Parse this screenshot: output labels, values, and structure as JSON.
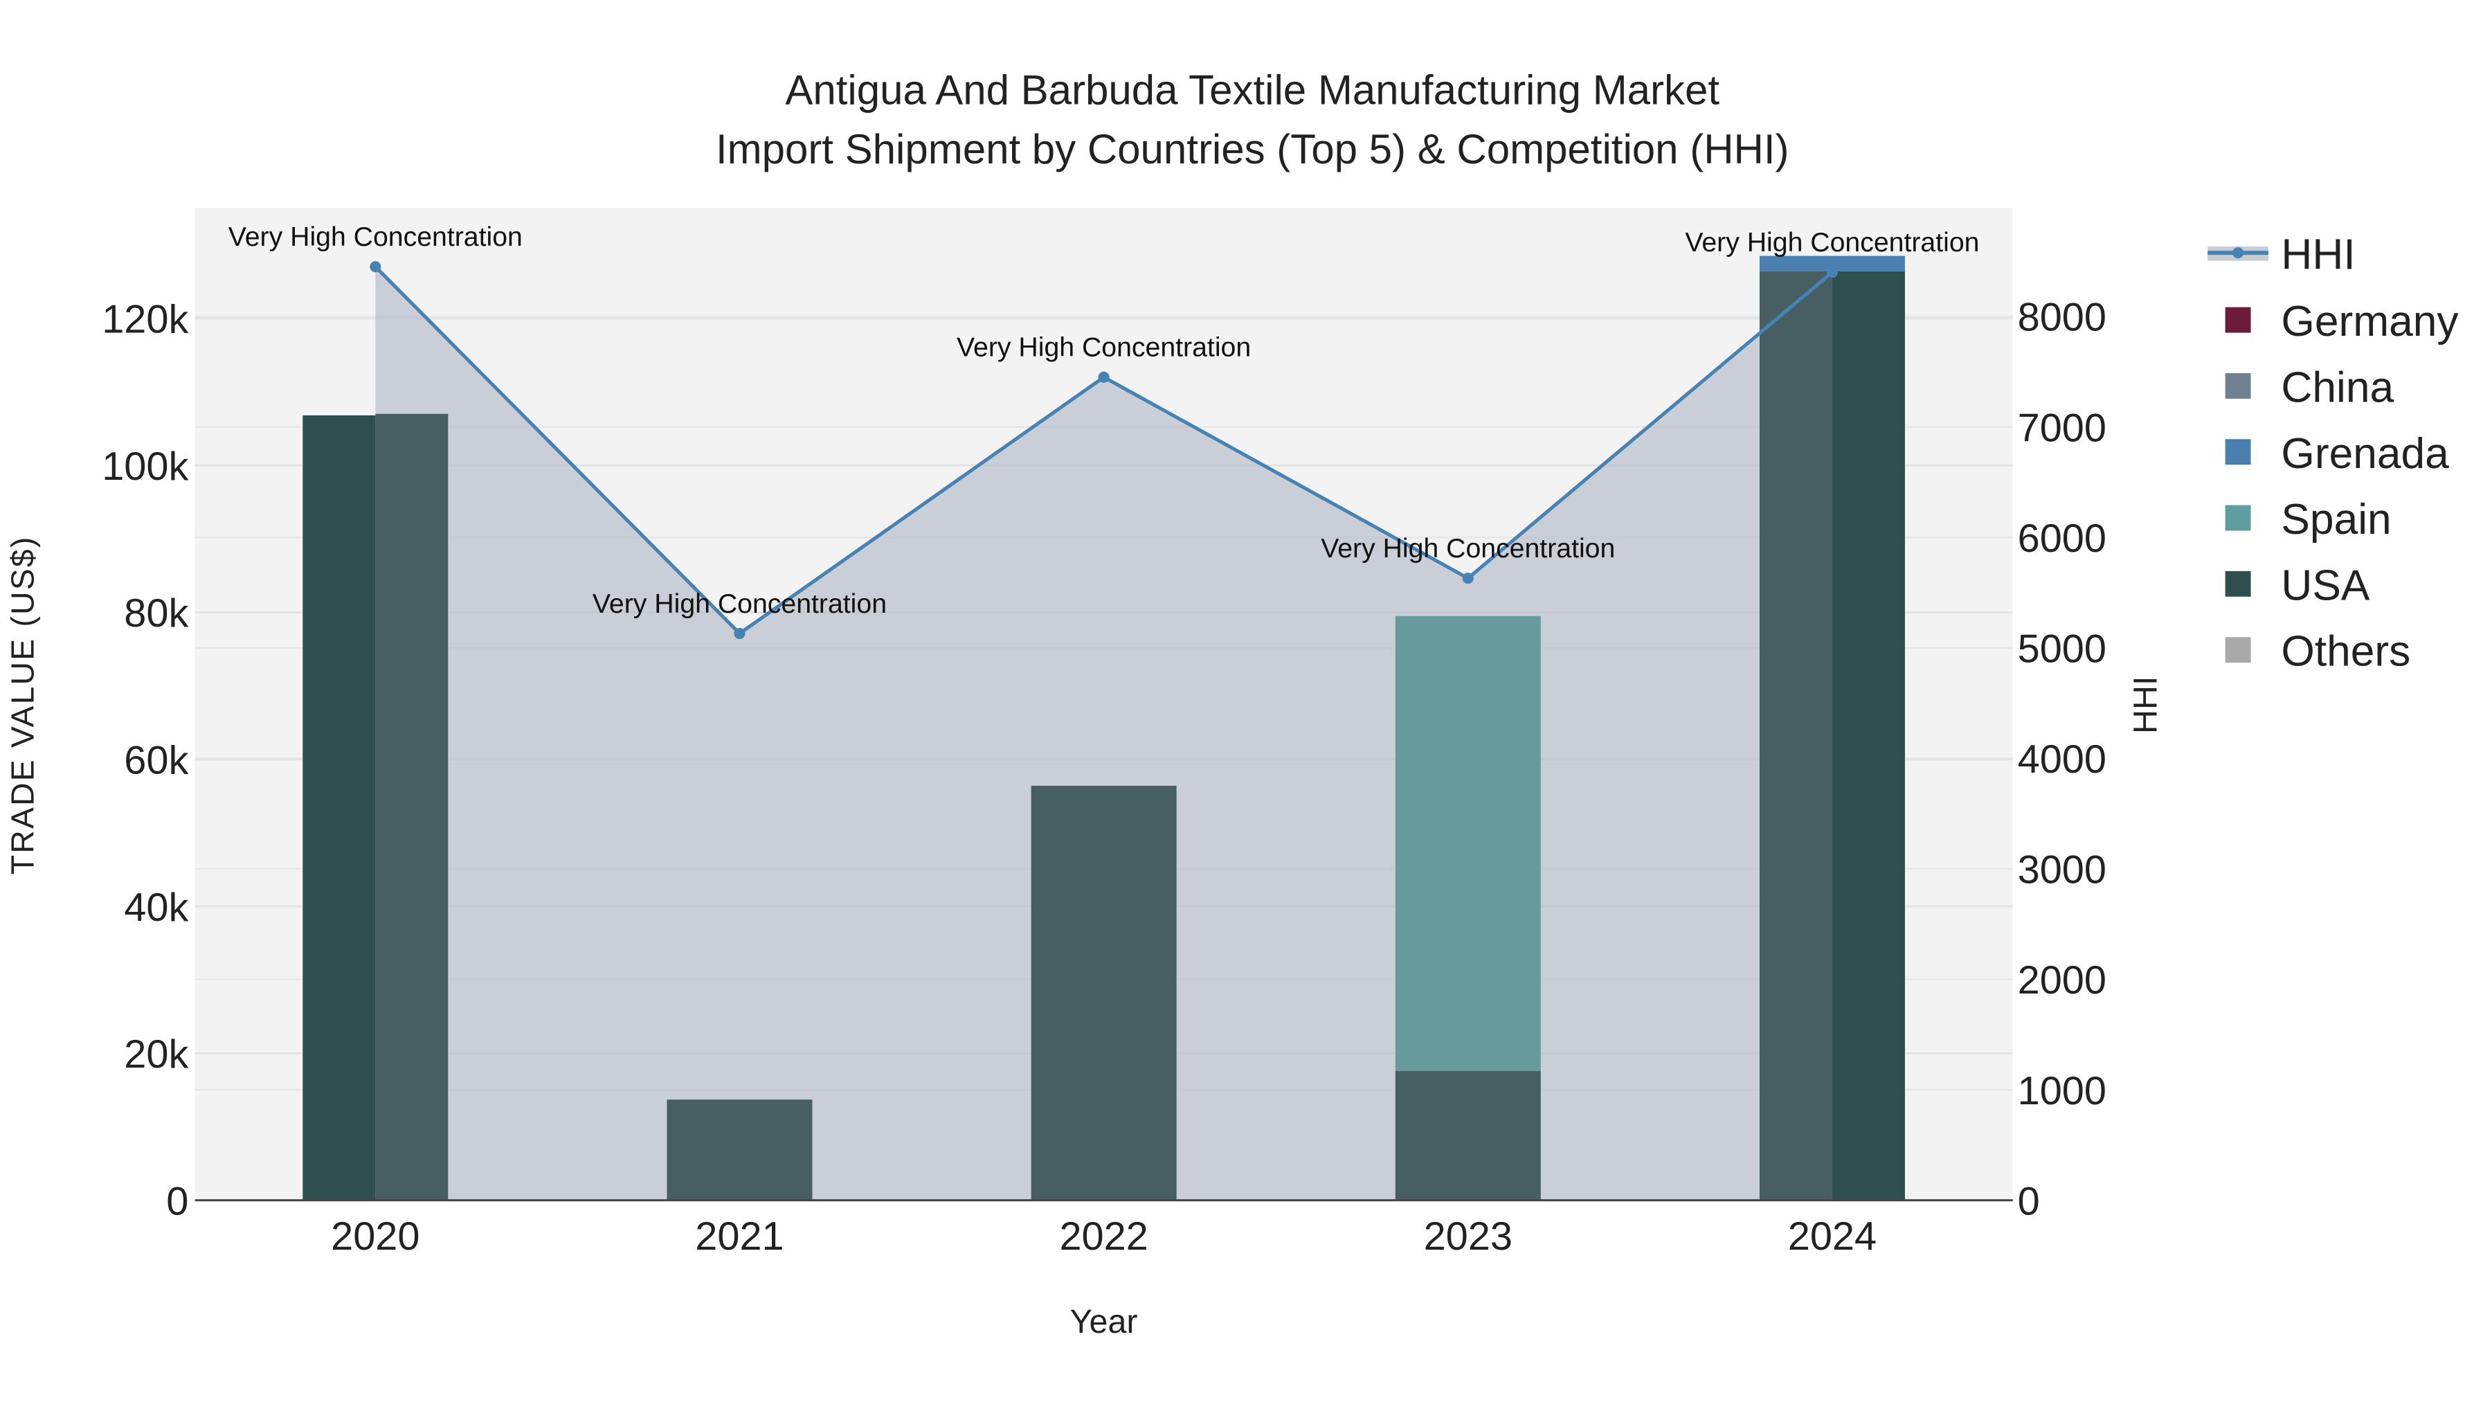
{
  "chart_data": {
    "type": "bar",
    "title_line1": "Antigua And Barbuda Textile Manufacturing Market",
    "title_line2": "Import Shipment by Countries (Top 5) & Competition (HHI)",
    "xlabel": "Year",
    "ylabel": "TRADE VALUE (US$)",
    "y2label": "HHI",
    "categories": [
      "2020",
      "2021",
      "2022",
      "2023",
      "2024"
    ],
    "ylim": [
      0,
      135000
    ],
    "y2lim": [
      0,
      8980
    ],
    "yticks": [
      0,
      20000,
      40000,
      60000,
      80000,
      100000,
      120000
    ],
    "ytick_labels": [
      "0",
      "20k",
      "40k",
      "60k",
      "80k",
      "100k",
      "120k"
    ],
    "y2ticks": [
      0,
      1000,
      2000,
      3000,
      4000,
      5000,
      6000,
      7000,
      8000
    ],
    "y2tick_labels": [
      "0",
      "1000",
      "2000",
      "3000",
      "4000",
      "5000",
      "6000",
      "7000",
      "8000"
    ],
    "series": [
      {
        "name": "Germany",
        "color": "#6b1a3a",
        "values": [
          0,
          0,
          0,
          0,
          0
        ]
      },
      {
        "name": "China",
        "color": "#708090",
        "bar_color": "#475f63",
        "values": [
          107000,
          13700,
          56400,
          17600,
          126400
        ]
      },
      {
        "name": "Grenada",
        "color": "#4a7fb0",
        "values": [
          0,
          0,
          0,
          0,
          2100
        ]
      },
      {
        "name": "Spain",
        "color": "#5f9ea0",
        "bar_color": "#669a9b",
        "values": [
          0,
          0,
          0,
          61900,
          0
        ]
      },
      {
        "name": "USA",
        "color": "#2f4f4f",
        "bar_color": "#2d4f4e",
        "values": [
          106800,
          0,
          0,
          0,
          126400
        ]
      },
      {
        "name": "Others",
        "color": "#a9a9a9",
        "values": [
          0,
          0,
          0,
          0,
          0
        ]
      }
    ],
    "hhi": {
      "name": "HHI",
      "color": "#4682b4",
      "values": [
        8450,
        5130,
        7450,
        5630,
        8400
      ],
      "annotations": [
        "Very High Concentration",
        "Very High Concentration",
        "Very High Concentration",
        "Very High Concentration",
        "Very High Concentration"
      ]
    },
    "legend_position": "right",
    "grid": true
  }
}
